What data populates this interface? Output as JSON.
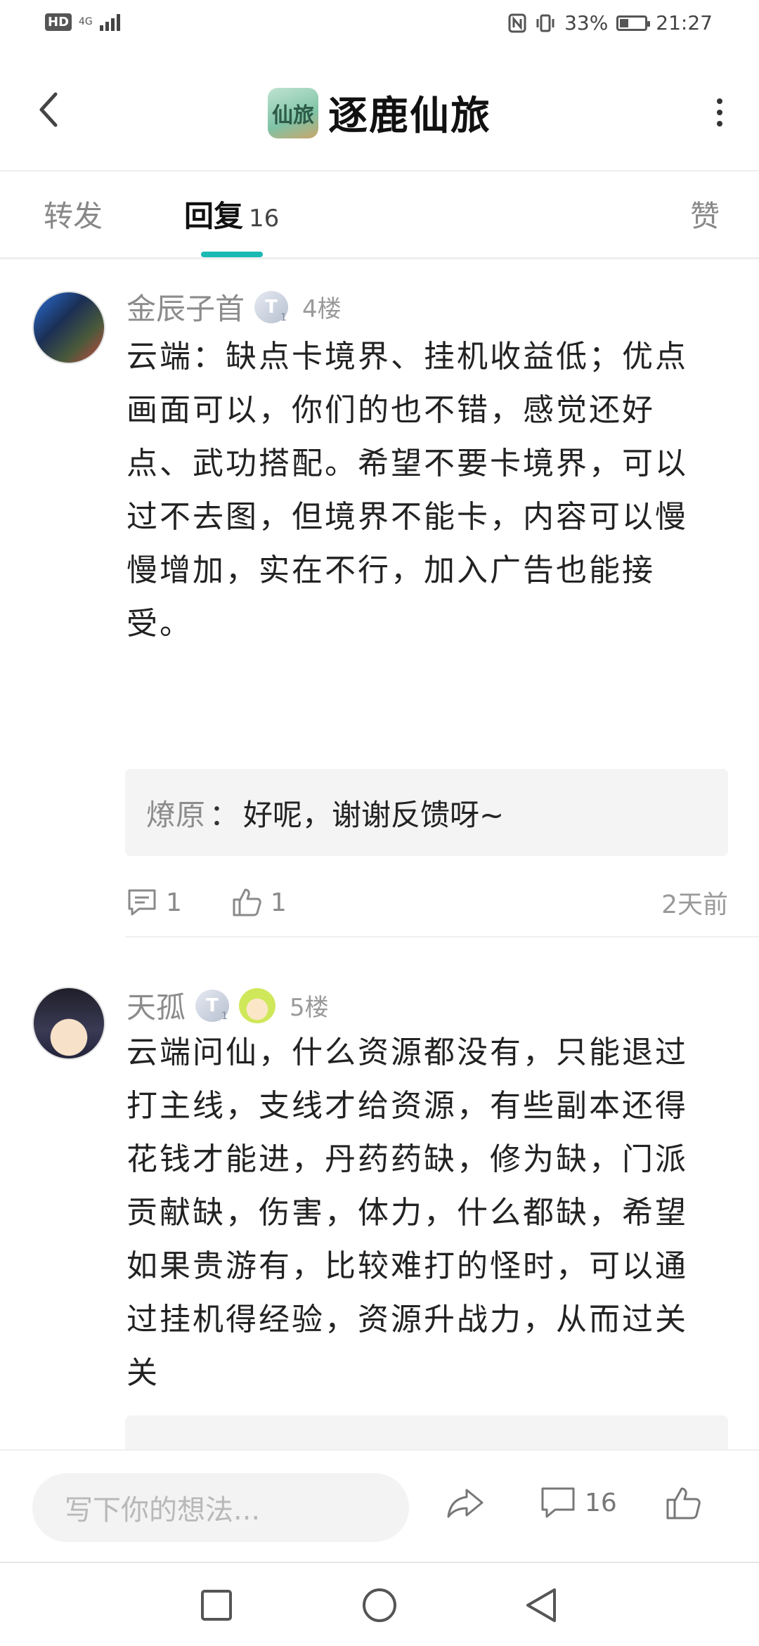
{
  "status_bar": {
    "hd": "HD",
    "network": "4G",
    "battery": "33%",
    "battery_level": 0.33,
    "time": "21:27"
  },
  "header": {
    "logo_text": "仙旅",
    "title": "逐鹿仙旅"
  },
  "tabs": {
    "forward": "转发",
    "reply": "回复",
    "reply_count": "16",
    "like": "赞"
  },
  "comments": [
    {
      "username": "金辰子首",
      "level": "T",
      "level_num": "1",
      "floor": "4楼",
      "text": "云端：缺点卡境界、挂机收益低；优点画面可以，你们的也不错，感觉还好点、武功搭配。希望不要卡境界，可以过不去图，但境界不能卡，内容可以慢慢增加，实在不行，加入广告也能接受。",
      "reply": {
        "author": "燎原",
        "sep": "：",
        "text": "好呢，谢谢反馈呀~"
      },
      "comment_count": "1",
      "like_count": "1",
      "time": "2天前"
    },
    {
      "username": "天孤",
      "level": "T",
      "level_num": "1",
      "floor": "5楼",
      "text": "云端问仙，什么资源都没有，只能退过打主线，支线才给资源，有些副本还得花钱才能进，丹药药缺，修为缺，门派贡献缺，伤害，体力，什么都缺，希望如果贵游有，比较难打的怪时，可以通过挂机得经验，资源升战力，从而过关关"
    }
  ],
  "bottom_bar": {
    "input_placeholder": "写下你的想法...",
    "comment_count": "16"
  },
  "icons": {
    "back": "back-arrow-icon",
    "more": "more-vertical-icon",
    "comment": "comment-icon",
    "like": "thumbs-up-icon",
    "share": "share-icon",
    "nav_recent": "square-icon",
    "nav_home": "circle-icon",
    "nav_back": "triangle-back-icon"
  },
  "colors": {
    "accent": "#1ab9b4",
    "muted_text": "#8c8c8c"
  }
}
